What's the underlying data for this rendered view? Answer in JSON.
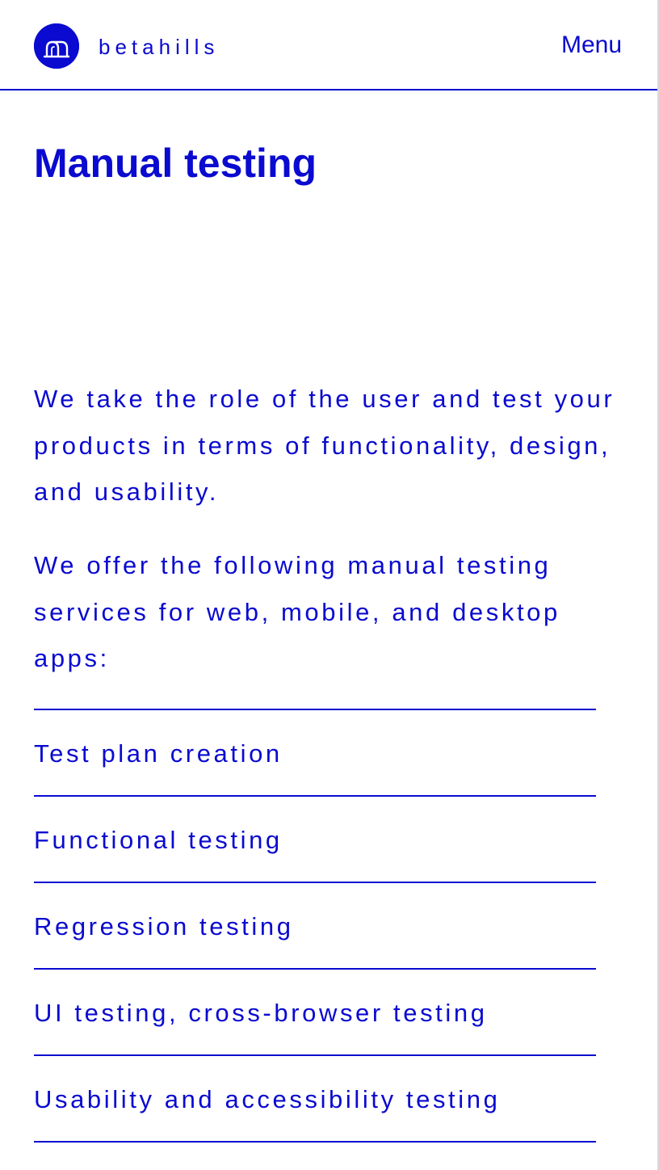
{
  "brand": {
    "name": "betahills",
    "logo_icon": "betahills-logo-icon",
    "color": "#0a0ad0"
  },
  "header": {
    "menu_label": "Menu"
  },
  "main": {
    "title": "Manual testing",
    "intro": "We take the role of the user and test your products in terms of functionality, design, and usability.",
    "services_intro": "We offer the following manual testing services for web, mobile, and desktop apps:",
    "services": [
      "Test plan creation",
      "Functional testing",
      "Regression testing",
      "UI testing, cross-browser testing",
      "Usability and accessibility testing"
    ]
  }
}
